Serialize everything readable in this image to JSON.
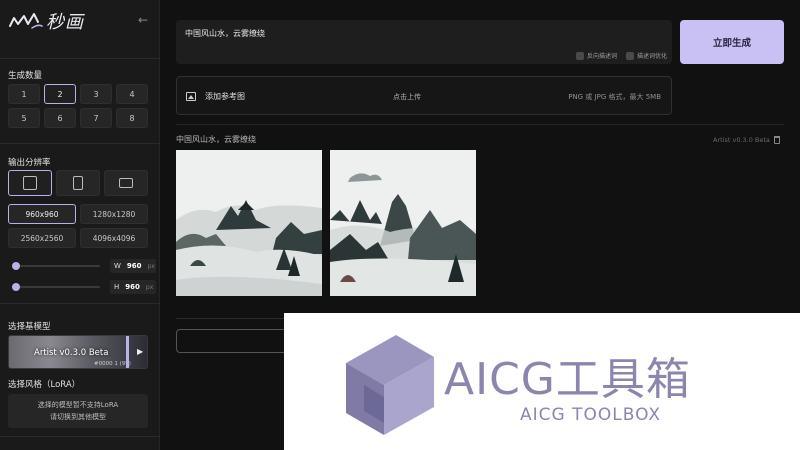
{
  "app": {
    "logo_text": "秒画"
  },
  "sidebar": {
    "quantity": {
      "title": "生成数量",
      "options": [
        "1",
        "2",
        "3",
        "4",
        "5",
        "6",
        "7",
        "8"
      ],
      "selected": "2"
    },
    "resolution": {
      "title": "输出分辨率",
      "ratios": [
        {
          "name": "square",
          "icon": "square-ratio-icon"
        },
        {
          "name": "portrait",
          "icon": "portrait-ratio-icon"
        },
        {
          "name": "landscape",
          "icon": "landscape-ratio-icon"
        }
      ],
      "selected_ratio": "square",
      "sizes": [
        "960x960",
        "1280x1280",
        "2560x2560",
        "4096x4096"
      ],
      "selected_size": "960x960",
      "width": {
        "label": "W",
        "value": "960",
        "unit": "px",
        "level": 0
      },
      "height": {
        "label": "H",
        "value": "960",
        "unit": "px",
        "level": 0
      }
    },
    "model": {
      "title": "选择基模型",
      "name": "Artist v0.3.0 Beta",
      "sub": "#0000 1 (99)"
    },
    "lora": {
      "title": "选择风格（LoRA）",
      "line1": "选择的模型暂不支持LoRA",
      "line2": "请切换到其他模型"
    }
  },
  "main": {
    "prompt": {
      "text": "中国风山水，云雾缭绕"
    },
    "options": {
      "negative": "反向描述词",
      "optimize": "描述词优化"
    },
    "generate_label": "立即生成",
    "upload": {
      "label": "添加参考图",
      "hint": "点击上传",
      "format": "PNG 或 JPG 格式，最大 5MB"
    },
    "result": {
      "caption": "中国风山水，云雾缭绕",
      "model": "Artist v0.3.0 Beta"
    }
  },
  "watermark": {
    "title": "AICG工具箱",
    "subtitle": "AICG TOOLBOX"
  },
  "colors": {
    "accent": "#b9b2e8",
    "generate": "#c9c0f4",
    "watermark": "#8a86ad"
  }
}
